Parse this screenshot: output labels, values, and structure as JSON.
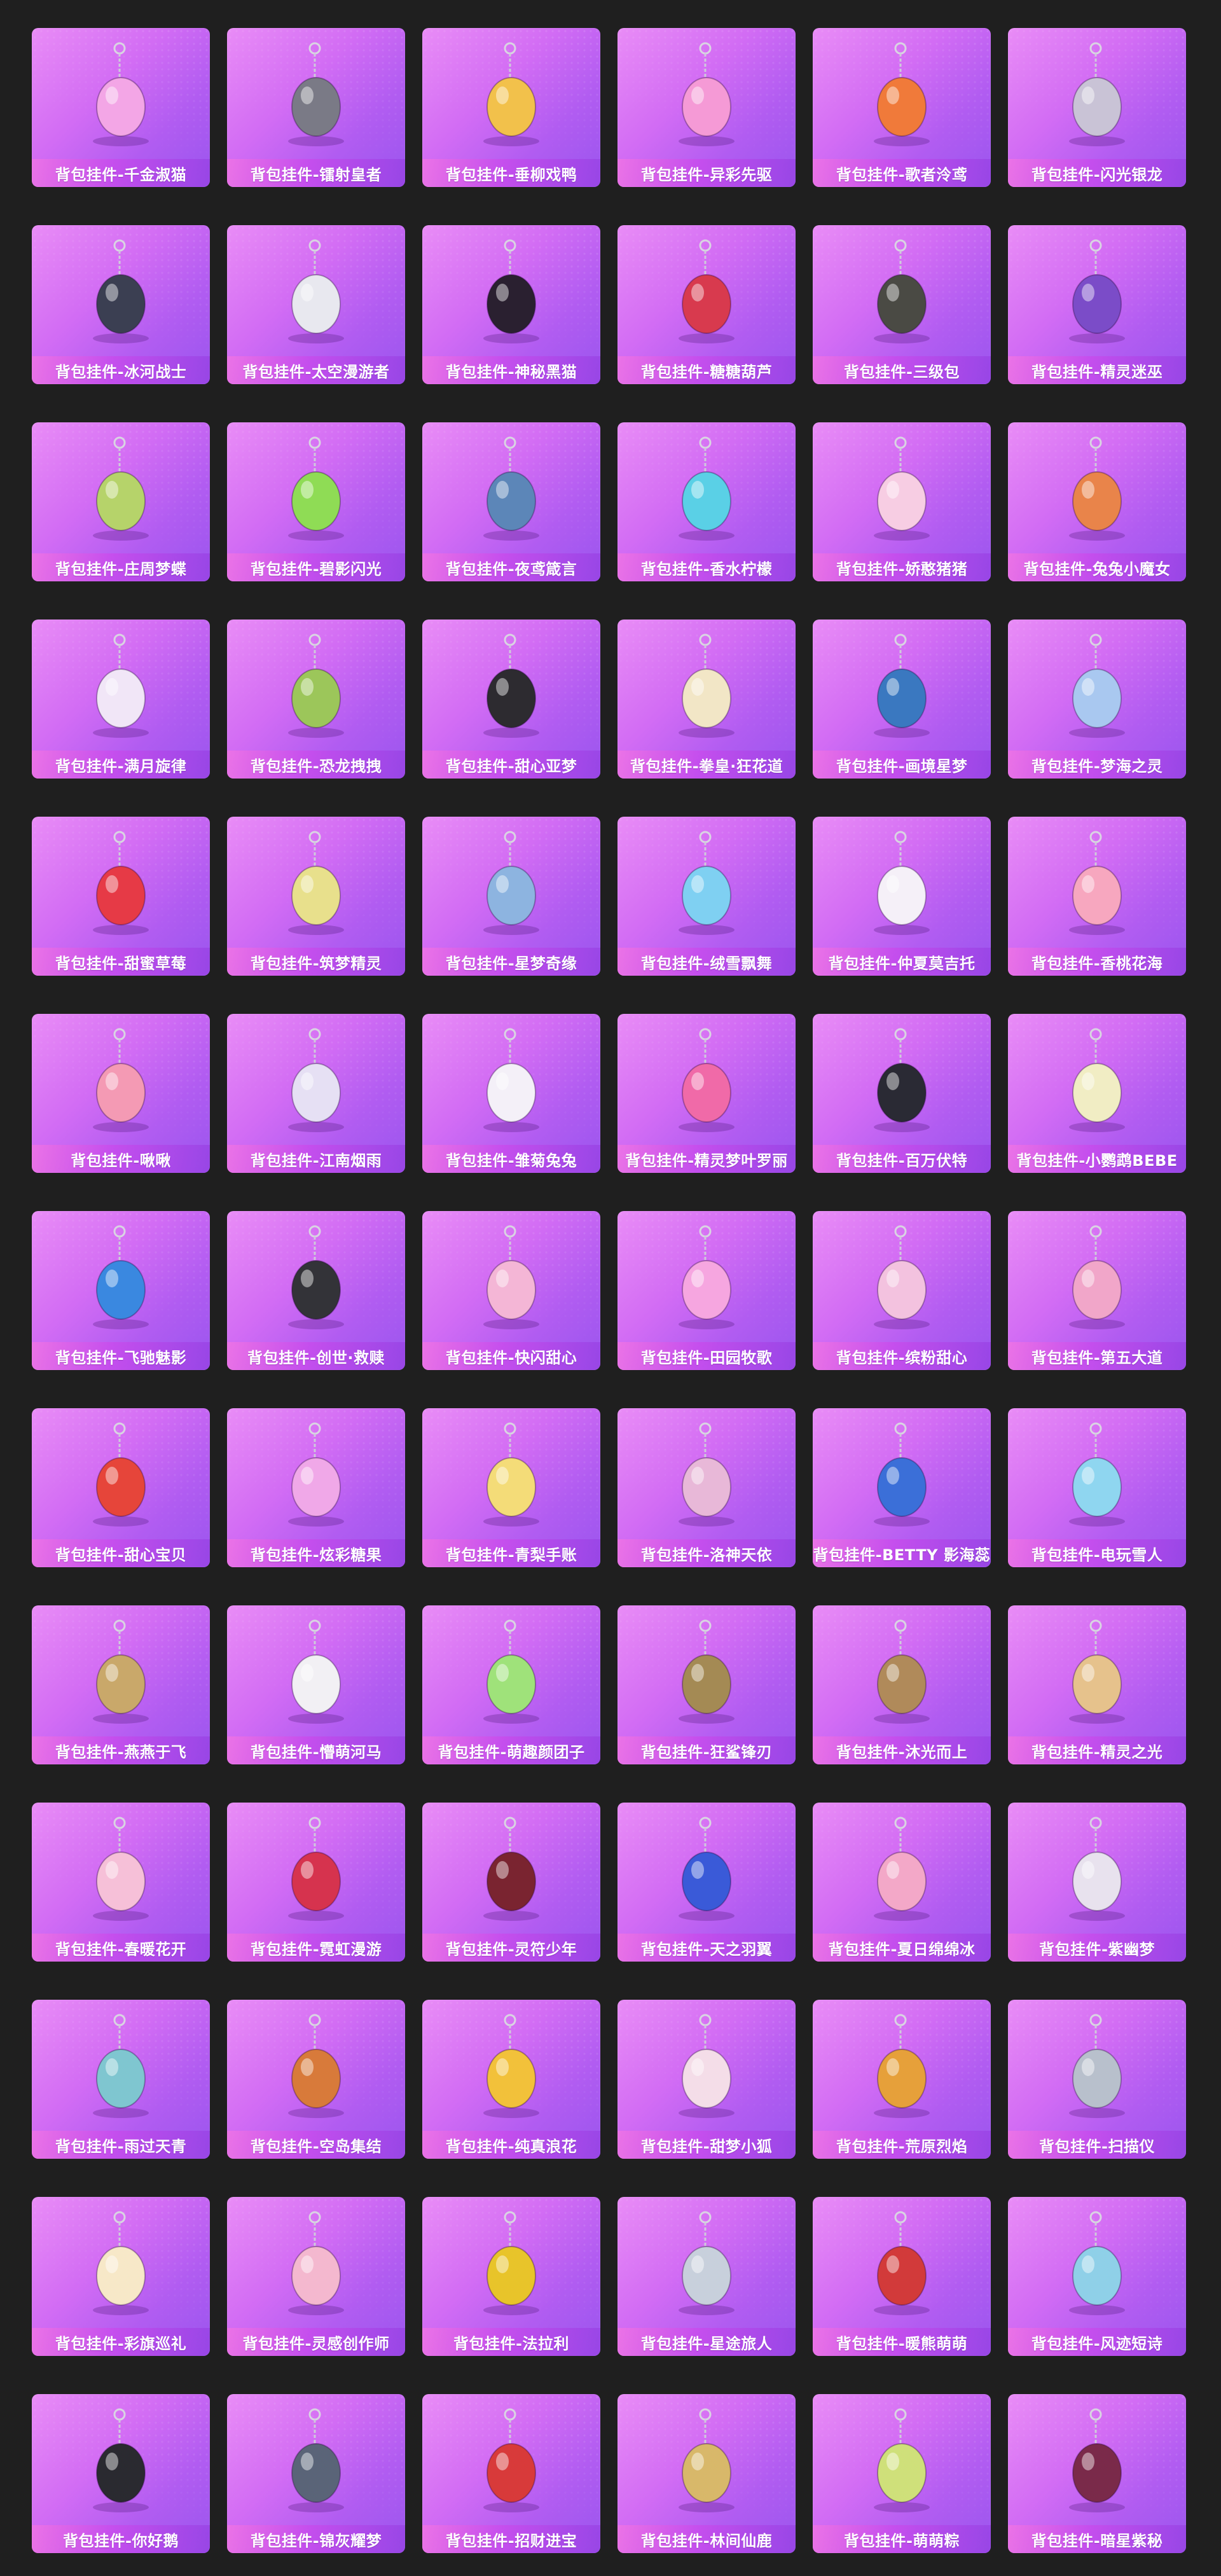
{
  "colors": {
    "page_background": "#1f1f1f",
    "card_gradient_start": "#e98cf6",
    "card_gradient_end": "#9a55ee",
    "label_text": "#ffffff"
  },
  "items": [
    {
      "label": "背包挂件-千金淑猫",
      "icon": "cat-charm-icon",
      "color": "#f3a6e6"
    },
    {
      "label": "背包挂件-镭射皇者",
      "icon": "headphones-charm-icon",
      "color": "#7a7a86"
    },
    {
      "label": "背包挂件-垂柳戏鸭",
      "icon": "duck-charm-icon",
      "color": "#f2c14b"
    },
    {
      "label": "背包挂件-异彩先驱",
      "icon": "roller-skate-charm-icon",
      "color": "#f59ad6"
    },
    {
      "label": "背包挂件-歌者泠鸢",
      "icon": "bird-charm-icon",
      "color": "#f07a3a"
    },
    {
      "label": "背包挂件-闪光银龙",
      "icon": "dragon-claw-charm-icon",
      "color": "#c9c3d6"
    },
    {
      "label": "背包挂件-冰河战士",
      "icon": "robot-charm-icon",
      "color": "#3b3f52"
    },
    {
      "label": "背包挂件-太空漫游者",
      "icon": "astronaut-charm-icon",
      "color": "#e8e8ef"
    },
    {
      "label": "背包挂件-神秘黑猫",
      "icon": "black-cat-charm-icon",
      "color": "#2a2030"
    },
    {
      "label": "背包挂件-糖糖葫芦",
      "icon": "candied-haws-charm-icon",
      "color": "#d83a4e"
    },
    {
      "label": "背包挂件-三级包",
      "icon": "backpack-charm-icon",
      "color": "#4a4a44"
    },
    {
      "label": "背包挂件-精灵迷巫",
      "icon": "potion-charm-icon",
      "color": "#7b4cc8"
    },
    {
      "label": "背包挂件-庄周梦蝶",
      "icon": "butterfly-charm-icon",
      "color": "#b6d36a"
    },
    {
      "label": "背包挂件-碧影闪光",
      "icon": "green-tag-charm-icon",
      "color": "#8fdc55"
    },
    {
      "label": "背包挂件-夜鸢箴言",
      "icon": "crest-charm-icon",
      "color": "#5c86b8"
    },
    {
      "label": "背包挂件-香水柠檬",
      "icon": "lemon-drink-charm-icon",
      "color": "#5ad0e6"
    },
    {
      "label": "背包挂件-娇憨猪猪",
      "icon": "pig-charm-icon",
      "color": "#f7cde3"
    },
    {
      "label": "背包挂件-兔兔小魔女",
      "icon": "witch-star-charm-icon",
      "color": "#e9844a"
    },
    {
      "label": "背包挂件-满月旋律",
      "icon": "music-note-charm-icon",
      "color": "#f1e6f7"
    },
    {
      "label": "背包挂件-恐龙拽拽",
      "icon": "dino-egg-charm-icon",
      "color": "#9cc65a"
    },
    {
      "label": "背包挂件-甜心亚梦",
      "icon": "paw-charm-icon",
      "color": "#2d2b30"
    },
    {
      "label": "背包挂件-拳皇·狂花道",
      "icon": "tassel-charm-icon",
      "color": "#f2e6c6"
    },
    {
      "label": "背包挂件-画境星梦",
      "icon": "wand-charm-icon",
      "color": "#3a78c0"
    },
    {
      "label": "背包挂件-梦海之灵",
      "icon": "shell-charm-icon",
      "color": "#a9c8f0"
    },
    {
      "label": "背包挂件-甜蜜草莓",
      "icon": "strawberry-charm-icon",
      "color": "#e63a46"
    },
    {
      "label": "背包挂件-筑梦精灵",
      "icon": "fairy-wings-charm-icon",
      "color": "#e8e08c"
    },
    {
      "label": "背包挂件-星梦奇缘",
      "icon": "orb-charm-icon",
      "color": "#8db4e0"
    },
    {
      "label": "背包挂件-绒雪飘舞",
      "icon": "jellyfish-charm-icon",
      "color": "#7fd0f2"
    },
    {
      "label": "背包挂件-仲夏莫吉托",
      "icon": "flower-beads-charm-icon",
      "color": "#f5f0f8"
    },
    {
      "label": "背包挂件-香桃花海",
      "icon": "peach-blossom-charm-icon",
      "color": "#f7a7bf"
    },
    {
      "label": "背包挂件-啾啾",
      "icon": "chick-plush-charm-icon",
      "color": "#f49ab4"
    },
    {
      "label": "背包挂件-江南烟雨",
      "icon": "crystal-charm-icon",
      "color": "#e6e0f4"
    },
    {
      "label": "背包挂件-雏菊兔兔",
      "icon": "bunny-charm-icon",
      "color": "#f4f0f8"
    },
    {
      "label": "背包挂件-精灵梦叶罗丽",
      "icon": "winged-heart-charm-icon",
      "color": "#f06aa8"
    },
    {
      "label": "背包挂件-百万伏特",
      "icon": "masked-cat-charm-icon",
      "color": "#2a2a34"
    },
    {
      "label": "背包挂件-小鹦鹉BEBE",
      "icon": "egg-charm-icon",
      "color": "#f1edc4"
    },
    {
      "label": "背包挂件-飞驰魅影",
      "icon": "winged-eye-charm-icon",
      "color": "#3a88e0"
    },
    {
      "label": "背包挂件-创世·救赎",
      "icon": "canister-charm-icon",
      "color": "#333338"
    },
    {
      "label": "背包挂件-快闪甜心",
      "icon": "donut-charm-icon",
      "color": "#f4b6d6"
    },
    {
      "label": "背包挂件-田园牧歌",
      "icon": "photo-card-charm-icon",
      "color": "#f6a6e0"
    },
    {
      "label": "背包挂件-缤粉甜心",
      "icon": "palette-charm-icon",
      "color": "#f3c2df"
    },
    {
      "label": "背包挂件-第五大道",
      "icon": "plaid-heart-charm-icon",
      "color": "#f1a6c9"
    },
    {
      "label": "背包挂件-甜心宝贝",
      "icon": "lollipop-charm-icon",
      "color": "#e6453a"
    },
    {
      "label": "背包挂件-炫彩糖果",
      "icon": "candy-charm-icon",
      "color": "#f0a8e8"
    },
    {
      "label": "背包挂件-青梨手账",
      "icon": "pear-charm-icon",
      "color": "#f4dc78"
    },
    {
      "label": "背包挂件-洛神天依",
      "icon": "ribbon-bow-charm-icon",
      "color": "#e8b8d8"
    },
    {
      "label": "背包挂件-BETTY 影海蕊",
      "icon": "swimsuit-charm-icon",
      "color": "#3b6fd8"
    },
    {
      "label": "背包挂件-电玩雪人",
      "icon": "arcade-charm-icon",
      "color": "#8fd6f0"
    },
    {
      "label": "背包挂件-燕燕于飞",
      "icon": "swallow-charm-icon",
      "color": "#c9a86a"
    },
    {
      "label": "背包挂件-懵萌河马",
      "icon": "feather-charm-icon",
      "color": "#f2f0f4"
    },
    {
      "label": "背包挂件-萌趣颜团子",
      "icon": "mochi-charm-icon",
      "color": "#9fe27a"
    },
    {
      "label": "背包挂件-狂鲨锋刃",
      "icon": "blade-charm-icon",
      "color": "#a48a54"
    },
    {
      "label": "背包挂件-沐光而上",
      "icon": "rifle-charm-icon",
      "color": "#b08a5a"
    },
    {
      "label": "背包挂件-精灵之光",
      "icon": "leaf-charm-icon",
      "color": "#e6c28c"
    },
    {
      "label": "背包挂件-春暖花开",
      "icon": "bow-flower-charm-icon",
      "color": "#f6c0d8"
    },
    {
      "label": "背包挂件-霓虹漫游",
      "icon": "gem-ring-charm-icon",
      "color": "#d6334e"
    },
    {
      "label": "背包挂件-灵符少年",
      "icon": "talisman-charm-icon",
      "color": "#7a2430"
    },
    {
      "label": "背包挂件-天之羽翼",
      "icon": "angel-heart-charm-icon",
      "color": "#3a5ad8"
    },
    {
      "label": "背包挂件-夏日绵绵冰",
      "icon": "ice-cream-charm-icon",
      "color": "#f3a8c8"
    },
    {
      "label": "背包挂件-紫幽梦",
      "icon": "bell-charm-icon",
      "color": "#e8e2ee"
    },
    {
      "label": "背包挂件-雨过天青",
      "icon": "crystal-wand-charm-icon",
      "color": "#7fc6d0"
    },
    {
      "label": "背包挂件-空岛集结",
      "icon": "key-charm-icon",
      "color": "#d87a3a"
    },
    {
      "label": "背包挂件-纯真浪花",
      "icon": "wrench-charm-icon",
      "color": "#f2c13a"
    },
    {
      "label": "背包挂件-甜梦小狐",
      "icon": "mushroom-charm-icon",
      "color": "#f4dde8"
    },
    {
      "label": "背包挂件-荒原烈焰",
      "icon": "sun-gear-charm-icon",
      "color": "#e6a03a"
    },
    {
      "label": "背包挂件-扫描仪",
      "icon": "ghost-shell-charm-icon",
      "color": "#b8c0cc"
    },
    {
      "label": "背包挂件-彩旗巡礼",
      "icon": "soft-serve-charm-icon",
      "color": "#f7e8c8"
    },
    {
      "label": "背包挂件-灵感创作师",
      "icon": "bear-plush-charm-icon",
      "color": "#f4b8cf"
    },
    {
      "label": "背包挂件-法拉利",
      "icon": "ferrari-shield-charm-icon",
      "color": "#e8c42a"
    },
    {
      "label": "背包挂件-星途旅人",
      "icon": "rocket-charm-icon",
      "color": "#c8d0dc"
    },
    {
      "label": "背包挂件-暖熊萌萌",
      "icon": "popcorn-charm-icon",
      "color": "#d23a3a"
    },
    {
      "label": "背包挂件-风迹短诗",
      "icon": "badge-charm-icon",
      "color": "#8fd0e8"
    },
    {
      "label": "背包挂件-你好鹅",
      "icon": "penguin-charm-icon",
      "color": "#2a2a30"
    },
    {
      "label": "背包挂件-锦灰耀梦",
      "icon": "crowbar-charm-icon",
      "color": "#5a6478"
    },
    {
      "label": "背包挂件-招财进宝",
      "icon": "lucky-doll-charm-icon",
      "color": "#d83a3a"
    },
    {
      "label": "背包挂件-林间仙鹿",
      "icon": "pyramid-earrings-charm-icon",
      "color": "#d8b86a"
    },
    {
      "label": "背包挂件-萌萌粽",
      "icon": "zongzi-charm-icon",
      "color": "#cfe07a"
    },
    {
      "label": "背包挂件-暗星紫秘",
      "icon": "dark-crest-charm-icon",
      "color": "#7a2a4a"
    }
  ]
}
